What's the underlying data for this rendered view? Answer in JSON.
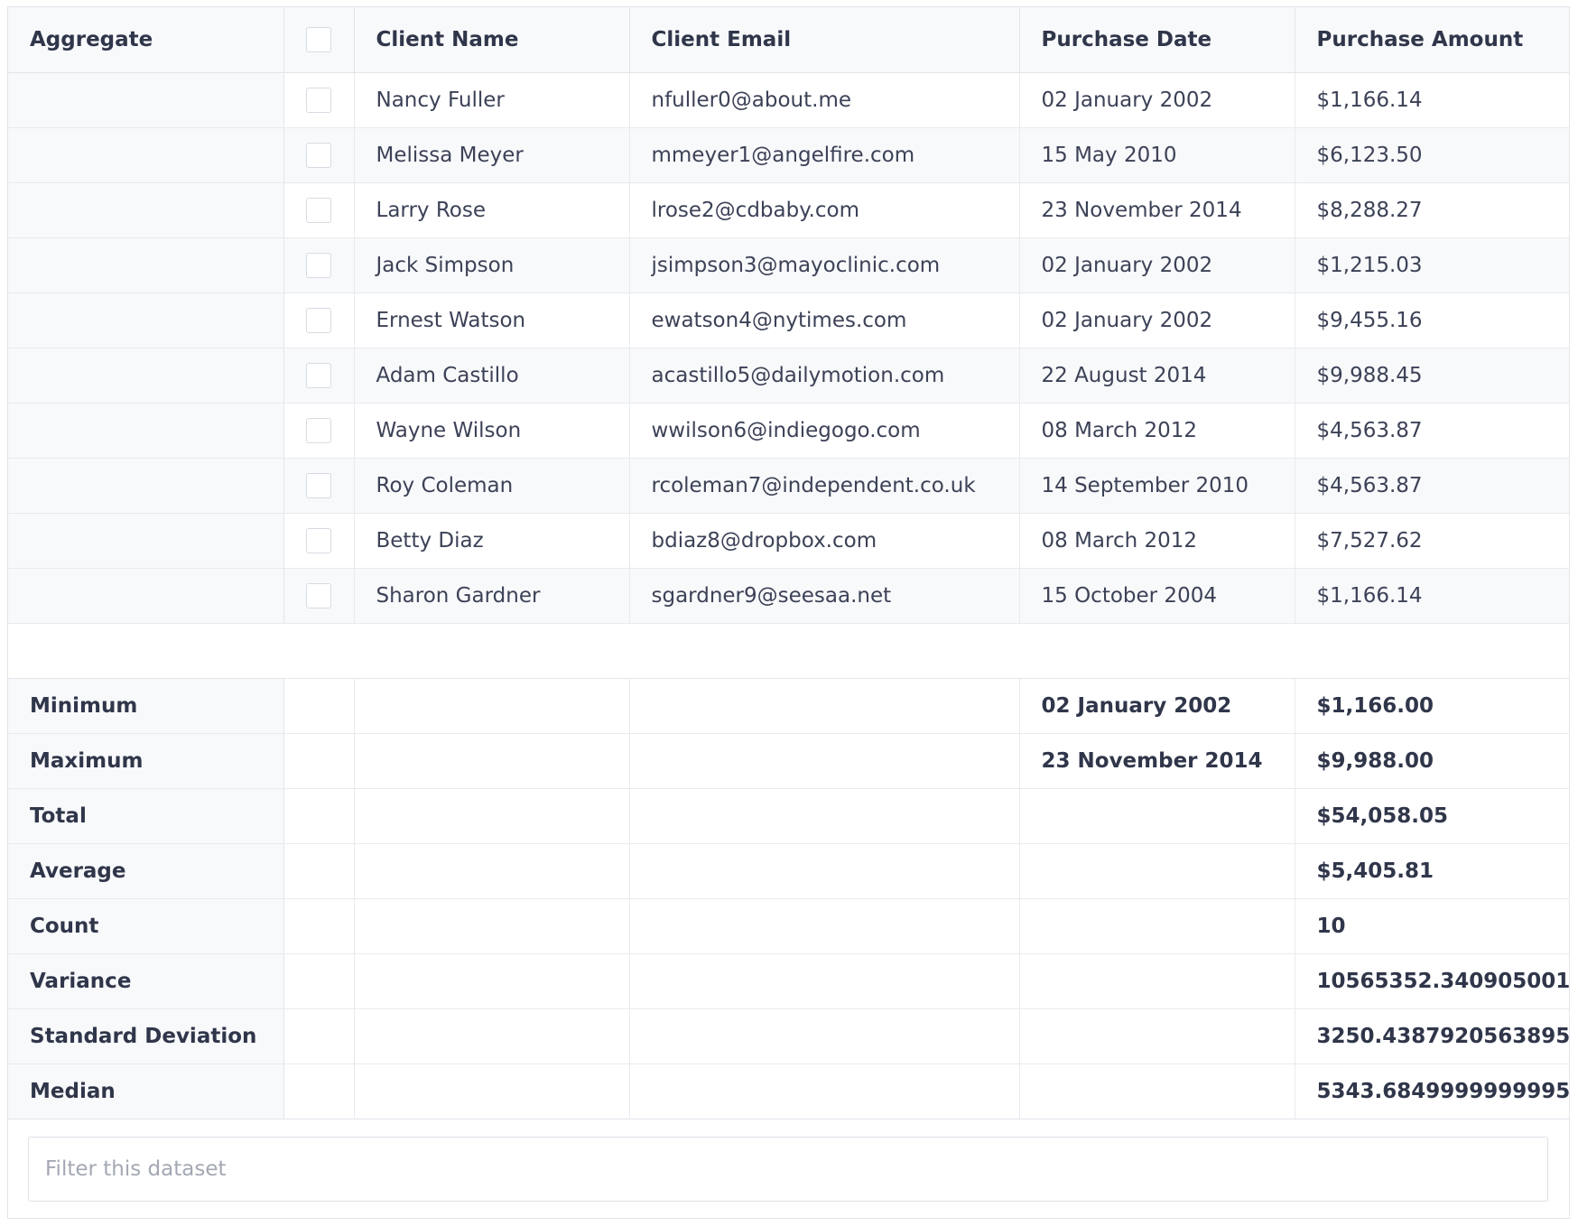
{
  "headers": {
    "aggregate": "Aggregate",
    "client_name": "Client Name",
    "client_email": "Client Email",
    "purchase_date": "Purchase Date",
    "purchase_amount": "Purchase Amount"
  },
  "rows": [
    {
      "name": "Nancy Fuller",
      "email": "nfuller0@about.me",
      "date": "02 January 2002",
      "amount": "$1,166.14"
    },
    {
      "name": "Melissa Meyer",
      "email": "mmeyer1@angelfire.com",
      "date": "15 May 2010",
      "amount": "$6,123.50"
    },
    {
      "name": "Larry Rose",
      "email": "lrose2@cdbaby.com",
      "date": "23 November 2014",
      "amount": "$8,288.27"
    },
    {
      "name": "Jack Simpson",
      "email": "jsimpson3@mayoclinic.com",
      "date": "02 January 2002",
      "amount": "$1,215.03"
    },
    {
      "name": "Ernest Watson",
      "email": "ewatson4@nytimes.com",
      "date": "02 January 2002",
      "amount": "$9,455.16"
    },
    {
      "name": "Adam Castillo",
      "email": "acastillo5@dailymotion.com",
      "date": "22 August 2014",
      "amount": "$9,988.45"
    },
    {
      "name": "Wayne Wilson",
      "email": "wwilson6@indiegogo.com",
      "date": "08 March 2012",
      "amount": "$4,563.87"
    },
    {
      "name": "Roy Coleman",
      "email": "rcoleman7@independent.co.uk",
      "date": "14 September 2010",
      "amount": "$4,563.87"
    },
    {
      "name": "Betty Diaz",
      "email": "bdiaz8@dropbox.com",
      "date": "08 March 2012",
      "amount": "$7,527.62"
    },
    {
      "name": "Sharon Gardner",
      "email": "sgardner9@seesaa.net",
      "date": "15 October 2004",
      "amount": "$1,166.14"
    }
  ],
  "aggregates": [
    {
      "label": "Minimum",
      "date": "02 January 2002",
      "amount": "$1,166.00"
    },
    {
      "label": "Maximum",
      "date": "23 November 2014",
      "amount": "$9,988.00"
    },
    {
      "label": "Total",
      "date": "",
      "amount": "$54,058.05"
    },
    {
      "label": "Average",
      "date": "",
      "amount": "$5,405.81"
    },
    {
      "label": "Count",
      "date": "",
      "amount": "10"
    },
    {
      "label": "Variance",
      "date": "",
      "amount": "10565352.340905001"
    },
    {
      "label": "Standard Deviation",
      "date": "",
      "amount": "3250.4387920563895"
    },
    {
      "label": "Median",
      "date": "",
      "amount": "5343.6849999999995"
    }
  ],
  "filter": {
    "placeholder": "Filter this dataset",
    "value": ""
  }
}
